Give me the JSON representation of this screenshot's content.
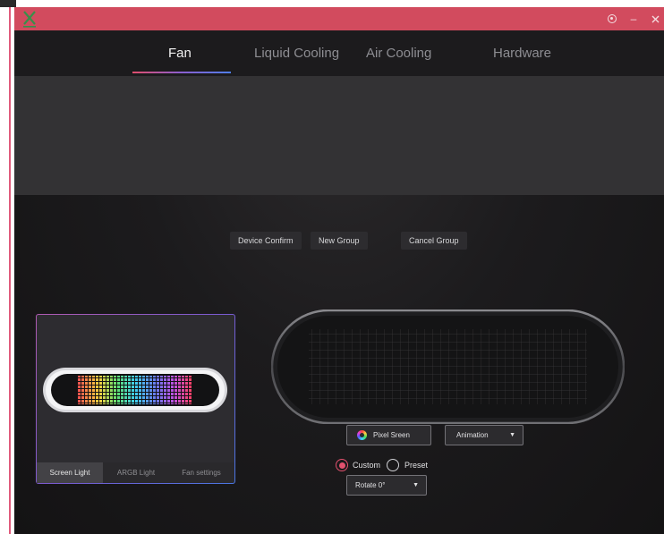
{
  "colors": {
    "accent": "#d24b5e",
    "radio_active": "#e2516e",
    "card_border_start": "#b05ab0",
    "card_border_end": "#4a76e2"
  },
  "window": {
    "controls": [
      "settings-icon",
      "minimize-icon",
      "close-icon"
    ],
    "minimize_glyph": "–"
  },
  "nav": {
    "tabs": [
      {
        "label": "Fan",
        "active": true
      },
      {
        "label": "Liquid Cooling",
        "active": false
      },
      {
        "label": "Air Cooling",
        "active": false
      },
      {
        "label": "Hardware",
        "active": false
      }
    ]
  },
  "group_actions": {
    "device_confirm": "Device Confirm",
    "new_group": "New Group",
    "cancel_group": "Cancel Group"
  },
  "fan_card": {
    "tabs": [
      {
        "label": "Screen Light",
        "active": true
      },
      {
        "label": "ARGB Light",
        "active": false
      },
      {
        "label": "Fan settings",
        "active": false
      }
    ]
  },
  "screen_controls": {
    "pixel_screen_label": "Pixel Sreen",
    "mode_select": {
      "value": "Animation",
      "icon": "caret-down-icon"
    },
    "source_options": [
      {
        "label": "Custom",
        "selected": true
      },
      {
        "label": "Preset",
        "selected": false
      }
    ],
    "rotate_select": {
      "value": "Rotate 0°",
      "icon": "caret-down-icon"
    }
  }
}
